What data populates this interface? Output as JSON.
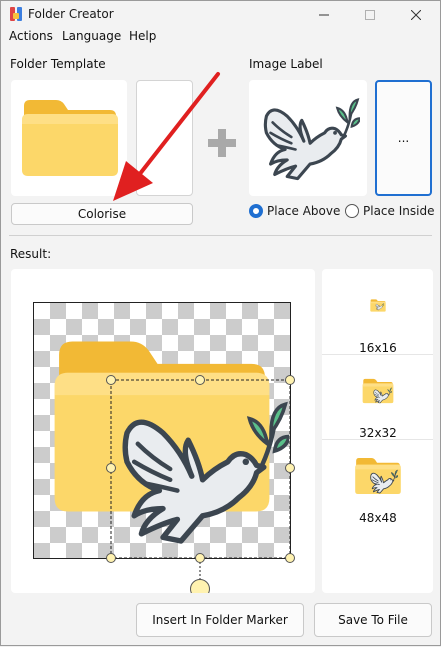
{
  "window": {
    "title": "Folder Creator",
    "icons": {
      "app": "folder-marker-app-icon",
      "minimize": "minimize-icon",
      "maximize": "maximize-icon",
      "close": "close-icon"
    }
  },
  "menu": {
    "actions": "Actions",
    "language": "Language",
    "help": "Help"
  },
  "template": {
    "label": "Folder Template",
    "colorise_button": "Colorise",
    "folder_color": "#f6c33e"
  },
  "image_label": {
    "label": "Image Label",
    "browse_button": "...",
    "placement_options": [
      {
        "label": "Place Above",
        "selected": true
      },
      {
        "label": "Place Inside",
        "selected": false
      }
    ],
    "accent_color": "#1f6fd1"
  },
  "result": {
    "label": "Result:",
    "previews": [
      {
        "size_label": "16x16"
      },
      {
        "size_label": "32x32"
      },
      {
        "size_label": "48x48"
      }
    ]
  },
  "actions": {
    "insert_button": "Insert In Folder Marker",
    "save_button": "Save To File"
  },
  "annotation": {
    "arrow_color": "#e02020"
  }
}
